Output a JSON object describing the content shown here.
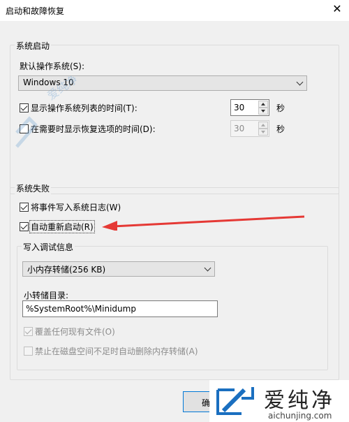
{
  "window": {
    "title": "启动和故障恢复",
    "close_glyph": "✕"
  },
  "system_startup": {
    "legend": "系统启动",
    "default_os_label": "默认操作系统(S):",
    "default_os_value": "Windows 10",
    "show_list_label": "显示操作系统列表的时间(T):",
    "show_list_checked": true,
    "show_list_value": "30",
    "show_list_unit": "秒",
    "show_recovery_label": "在需要时显示恢复选项的时间(D):",
    "show_recovery_checked": false,
    "show_recovery_value": "30",
    "show_recovery_unit": "秒"
  },
  "system_failure": {
    "legend": "系统失败",
    "write_event_label": "将事件写入系统日志(W)",
    "write_event_checked": true,
    "auto_restart_label": "自动重新启动(R)",
    "auto_restart_checked": true,
    "debug_legend": "写入调试信息",
    "dump_type_value": "小内存转储(256 KB)",
    "dump_dir_label": "小转储目录:",
    "dump_dir_value": "%SystemRoot%\\Minidump",
    "overwrite_label": "覆盖任何现有文件(O)",
    "overwrite_checked": true,
    "disable_auto_delete_label": "禁止在磁盘空间不足时自动删除内存转储(A)",
    "disable_auto_delete_checked": false
  },
  "buttons": {
    "ok_label": "确"
  },
  "watermark": {
    "brand": "爱纯净",
    "url": "aichunjing.com",
    "faint_text": "爱纯净"
  },
  "colors": {
    "arrow": "#e53935",
    "accent": "#0078d7",
    "watermark_blue": "#1a6fc0"
  }
}
